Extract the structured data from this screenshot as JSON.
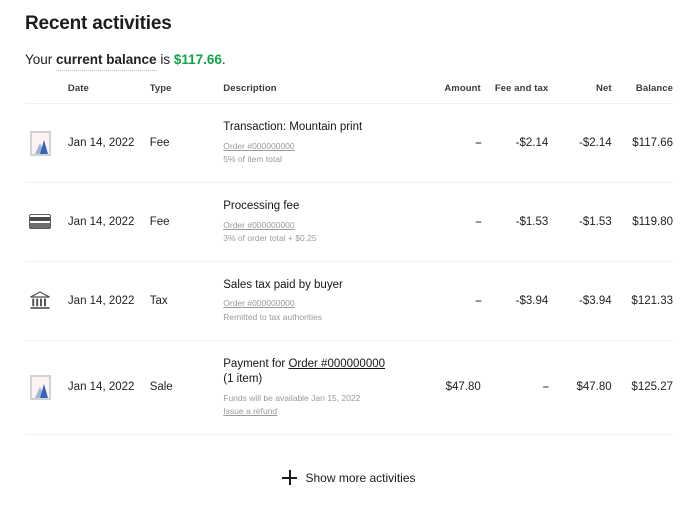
{
  "header": {
    "title": "Recent activities",
    "balance_prefix": "Your ",
    "balance_label": "current balance",
    "balance_mid": " is ",
    "balance_amount": "$117.66",
    "balance_suffix": ".",
    "balance_color": "#14a24a"
  },
  "table": {
    "columns": {
      "date": "Date",
      "type": "Type",
      "description": "Description",
      "amount": "Amount",
      "fee_and_tax": "Fee and tax",
      "net": "Net",
      "balance": "Balance"
    },
    "rows": [
      {
        "icon": "picture-thumbnail-icon",
        "date": "Jan 14, 2022",
        "type": "Fee",
        "title": "Transaction: Mountain print",
        "title_link": "",
        "title_line2": "",
        "sub1": "Order #000000000",
        "sub1_link": true,
        "sub2": "5% of item total",
        "sub2_link": false,
        "sub3": "",
        "sub3_link": false,
        "amount": "--",
        "amount_is_dash": true,
        "fee_and_tax": "-$2.14",
        "net": "-$2.14",
        "balance": "$117.66"
      },
      {
        "icon": "credit-card-icon",
        "date": "Jan 14, 2022",
        "type": "Fee",
        "title": "Processing fee",
        "title_link": "",
        "title_line2": "",
        "sub1": "Order #000000000",
        "sub1_link": true,
        "sub2": "3% of order total + $0.25",
        "sub2_link": false,
        "sub3": "",
        "sub3_link": false,
        "amount": "--",
        "amount_is_dash": true,
        "fee_and_tax": "-$1.53",
        "net": "-$1.53",
        "balance": "$119.80"
      },
      {
        "icon": "bank-icon",
        "date": "Jan 14, 2022",
        "type": "Tax",
        "title": "Sales tax paid by buyer",
        "title_link": "",
        "title_line2": "",
        "sub1": "Order #000000000",
        "sub1_link": true,
        "sub2": "Remitted to tax authorities",
        "sub2_link": false,
        "sub3": "",
        "sub3_link": false,
        "amount": "--",
        "amount_is_dash": true,
        "fee_and_tax": "-$3.94",
        "net": "-$3.94",
        "balance": "$121.33"
      },
      {
        "icon": "picture-thumbnail-icon",
        "date": "Jan 14, 2022",
        "type": "Sale",
        "title": "Payment for ",
        "title_link": "Order #000000000",
        "title_line2": "(1 item)",
        "sub1": "Funds will be available Jan 15, 2022",
        "sub1_link": false,
        "sub2": "Issue a refund",
        "sub2_link": true,
        "sub3": "",
        "sub3_link": false,
        "amount": "$47.80",
        "amount_is_dash": false,
        "fee_and_tax": "--",
        "net": "$47.80",
        "balance": "$125.27"
      }
    ]
  },
  "footer": {
    "show_more_label": "Show more activities"
  }
}
